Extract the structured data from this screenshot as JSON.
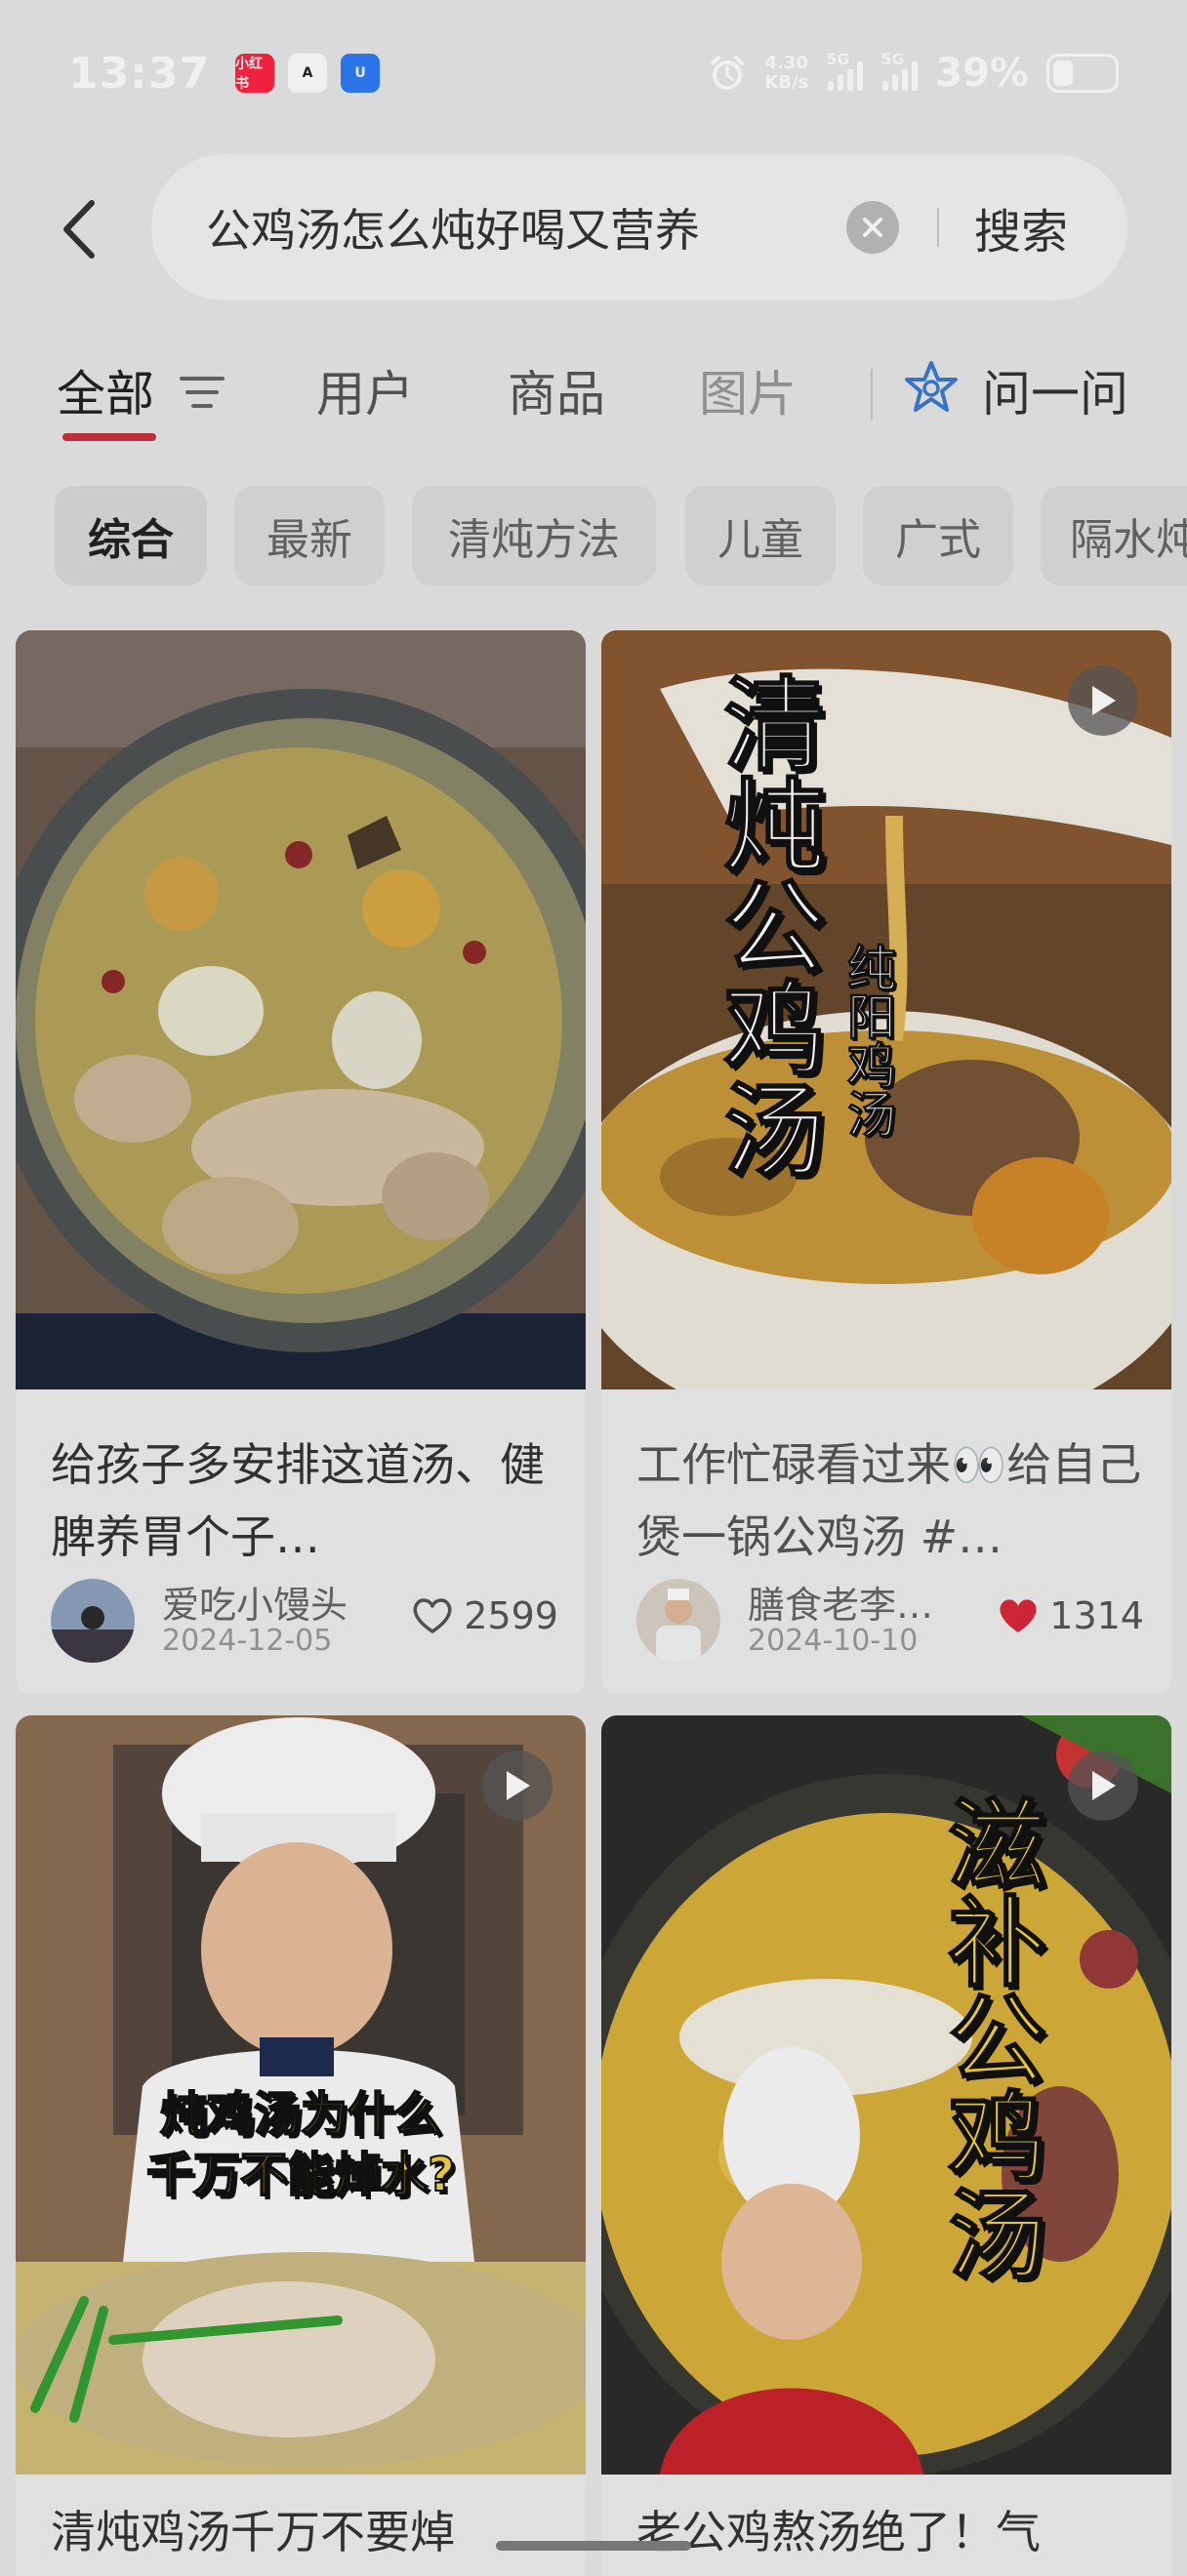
{
  "status_bar": {
    "time": "13:37",
    "app_icons": [
      "小红书",
      "A",
      "U"
    ],
    "net_speed_value": "4.30",
    "net_speed_unit": "KB/s",
    "signal1_label": "5G",
    "signal2_label": "5G",
    "battery_percent": "39%"
  },
  "search": {
    "query": "公鸡汤怎么炖好喝又营养",
    "button_label": "搜索"
  },
  "tabs": {
    "all": "全部",
    "users": "用户",
    "goods": "商品",
    "images": "图片",
    "ask": "问一问"
  },
  "chips": [
    "综合",
    "最新",
    "清炖方法",
    "儿童",
    "广式",
    "隔水炖"
  ],
  "cards": [
    {
      "title": "给孩子多安排这道汤、健脾养胃个子…",
      "author": "爱吃小馒头",
      "date": "2024-12-05",
      "likes": "2599",
      "liked": false,
      "is_video": false,
      "overlay": ""
    },
    {
      "title": "工作忙碌看过来👀给自己煲一锅公鸡汤 #…",
      "author": "膳食老李…",
      "date": "2024-10-10",
      "likes": "1314",
      "liked": true,
      "is_video": true,
      "overlay_main": "清炖公鸡汤",
      "overlay_sub": "纯阳鸡汤"
    },
    {
      "title": "清炖鸡汤千万不要焯",
      "is_video": true,
      "overlay_line1": "炖鸡汤为什么",
      "overlay_line2": "千万不能焯水?"
    },
    {
      "title": "老公鸡熬汤绝了！气",
      "is_video": true,
      "overlay_main": "滋补公鸡汤"
    }
  ],
  "colors": {
    "accent_red": "#c9323e",
    "heart_red": "#d8283a",
    "xiaohongshu_red": "#ff2442",
    "blue_icon": "#2e7cf6"
  }
}
